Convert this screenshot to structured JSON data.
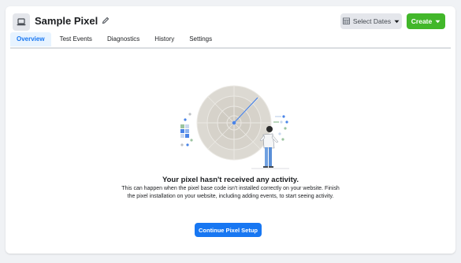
{
  "header": {
    "title": "Sample Pixel",
    "icons": {
      "pixel": "laptop-icon",
      "edit": "pencil-icon"
    }
  },
  "toolbar": {
    "dates_label": "Select Dates",
    "dates_icon": "calendar-icon",
    "create_label": "Create"
  },
  "tabs": [
    {
      "label": "Overview",
      "active": true
    },
    {
      "label": "Test Events",
      "active": false
    },
    {
      "label": "Diagnostics",
      "active": false
    },
    {
      "label": "History",
      "active": false
    },
    {
      "label": "Settings",
      "active": false
    }
  ],
  "empty_state": {
    "illustration": "radar-scan-illustration",
    "title": "Your pixel hasn't received any activity.",
    "description": "This can happen when the pixel base code isn't installed correctly on your website. Finish the pixel installation on your website, including adding events, to start seeing activity.",
    "button_label": "Continue Pixel Setup"
  },
  "colors": {
    "primary": "#1877f2",
    "create": "#42b72a",
    "active_tab_bg": "#e7f3ff",
    "page_bg": "#f0f2f5"
  }
}
